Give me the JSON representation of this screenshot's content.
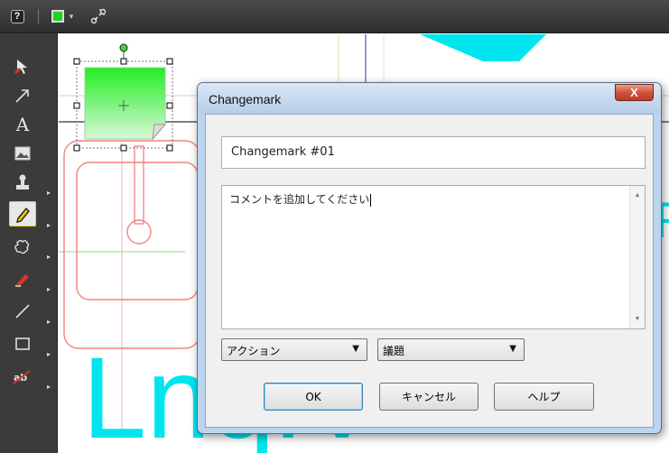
{
  "toolbar": {
    "help_icon": "?",
    "accent_color": "#1fd21f",
    "dropdown_icon": "▾",
    "link_icon": "link-icon"
  },
  "tools": [
    {
      "name": "select-tool",
      "icon": "arrow-select-icon"
    },
    {
      "name": "arrow-tool",
      "icon": "arrow-icon"
    },
    {
      "name": "text-tool",
      "icon": "A"
    },
    {
      "name": "image-tool",
      "icon": "image-icon"
    },
    {
      "name": "stamp-tool",
      "icon": "stamp-icon"
    },
    {
      "name": "changemark-tool",
      "icon": "pencil-note-icon",
      "active": true
    },
    {
      "name": "cloud-tool",
      "icon": "cloud-icon"
    },
    {
      "name": "highlighter-tool",
      "icon": "highlighter-icon"
    },
    {
      "name": "line-tool",
      "icon": "line-icon"
    },
    {
      "name": "rectangle-tool",
      "icon": "rectangle-icon"
    },
    {
      "name": "strikeout-tool",
      "icon": "abc-strike-icon"
    }
  ],
  "canvas": {
    "big_text": "Lnqrv",
    "partial_letter": "R",
    "accent_cyan": "#00e5ee"
  },
  "dialog": {
    "title": "Changemark",
    "close_label": "X",
    "name_value": "Changemark #01",
    "comment_text": "コメントを追加してください",
    "action_selected": "アクション",
    "subject_selected": "議題",
    "ok_label": "OK",
    "cancel_label": "キャンセル",
    "help_label": "ヘルプ"
  }
}
